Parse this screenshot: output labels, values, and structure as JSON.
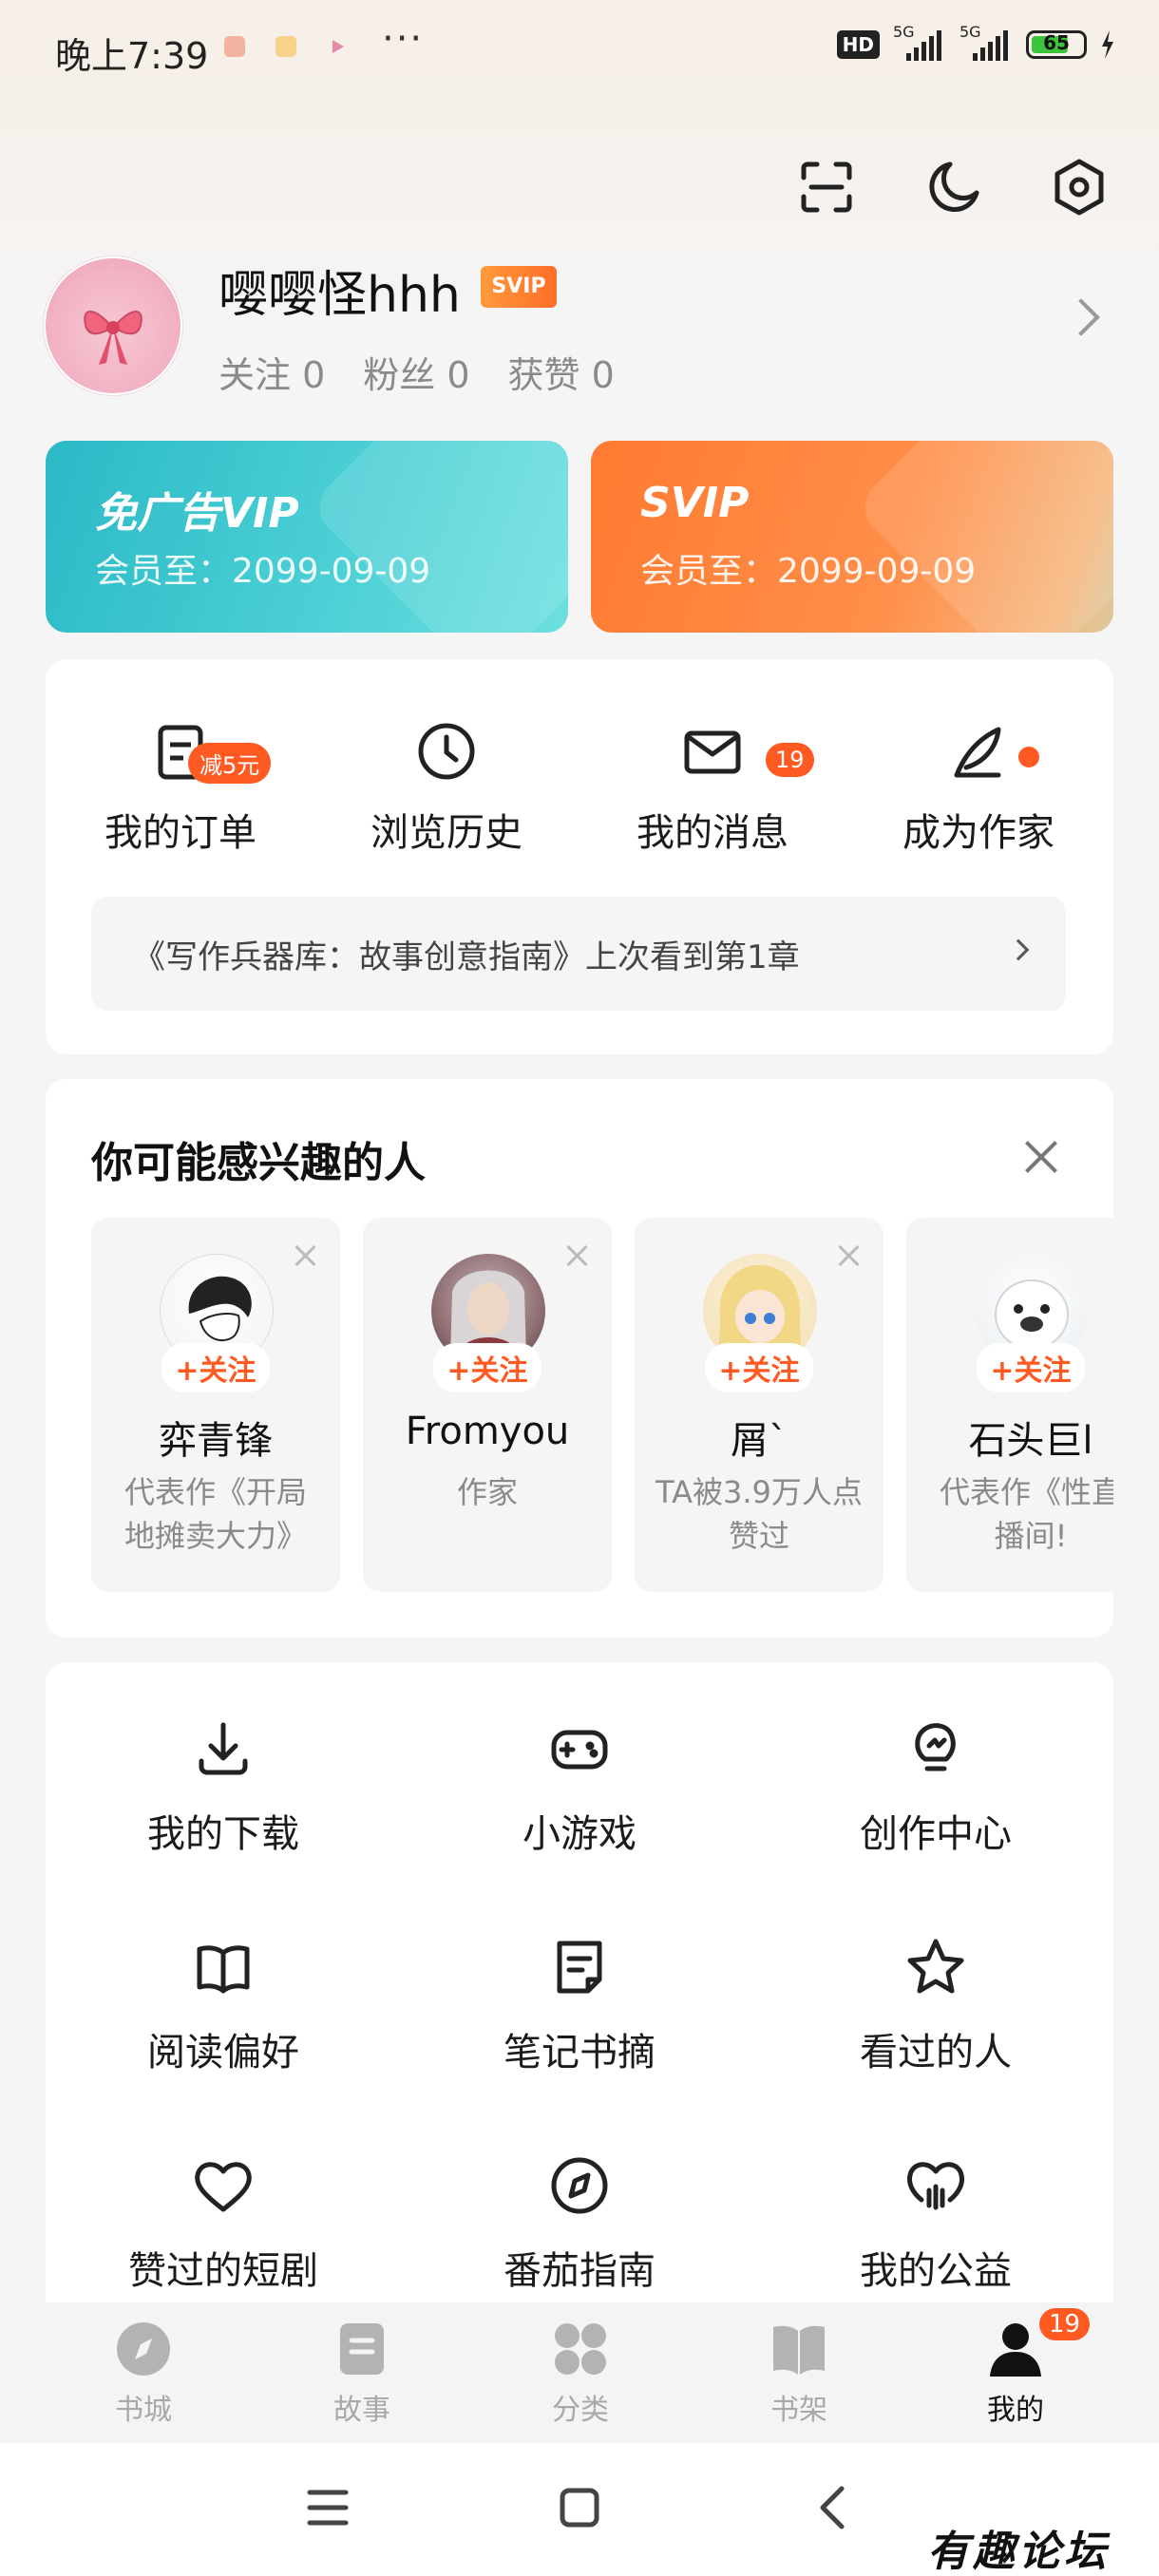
{
  "status_bar": {
    "time": "晚上7:39",
    "dots": "···",
    "hd": "HD",
    "net1": "5G",
    "net2": "5G",
    "battery": "65"
  },
  "profile": {
    "username": "嘤嘤怪hhh",
    "badge": "SVIP",
    "stats": [
      "关注 0",
      "粉丝 0",
      "获赞 0"
    ]
  },
  "vip_cards": [
    {
      "title": "免广告VIP",
      "sub": "会员至：2099-09-09",
      "color": "#2bb9c6"
    },
    {
      "title": "SVIP",
      "sub": "会员至：2099-09-09",
      "color": "#ff7a31"
    }
  ],
  "quick_actions": [
    {
      "label": "我的订单",
      "icon": "order-icon",
      "badge": "减5元"
    },
    {
      "label": "浏览历史",
      "icon": "clock-icon",
      "badge": ""
    },
    {
      "label": "我的消息",
      "icon": "mail-icon",
      "badge": "19"
    },
    {
      "label": "成为作家",
      "icon": "quill-icon",
      "badge": ""
    }
  ],
  "history": {
    "text": "《写作兵器库：故事创意指南》上次看到第1章"
  },
  "recommend": {
    "title": "你可能感兴趣的人",
    "follow_label": "+关注",
    "people": [
      {
        "name": "弈青锋",
        "desc": "代表作《开局地摊卖大力》"
      },
      {
        "name": "Fromyou",
        "desc": "作家"
      },
      {
        "name": "屑`",
        "desc": "TA被3.9万人点赞过"
      },
      {
        "name": "石头巨l",
        "desc": "代表作《性直播间!"
      }
    ]
  },
  "grid": [
    {
      "label": "我的下载",
      "icon": "download-icon"
    },
    {
      "label": "小游戏",
      "icon": "gamepad-icon"
    },
    {
      "label": "创作中心",
      "icon": "bulb-icon"
    },
    {
      "label": "阅读偏好",
      "icon": "book-icon"
    },
    {
      "label": "笔记书摘",
      "icon": "note-icon"
    },
    {
      "label": "看过的人",
      "icon": "star-icon"
    },
    {
      "label": "赞过的短剧",
      "icon": "heart-icon"
    },
    {
      "label": "番茄指南",
      "icon": "compass-icon"
    },
    {
      "label": "我的公益",
      "icon": "charity-icon"
    }
  ],
  "tabs": [
    {
      "label": "书城",
      "icon": "compass-tab-icon"
    },
    {
      "label": "故事",
      "icon": "story-tab-icon"
    },
    {
      "label": "分类",
      "icon": "category-tab-icon"
    },
    {
      "label": "书架",
      "icon": "bookshelf-tab-icon"
    },
    {
      "label": "我的",
      "icon": "me-tab-icon",
      "badge": "19"
    }
  ],
  "watermark": "有趣论坛",
  "colors": {
    "accent": "#ff5a22",
    "text": "#1b1b1b",
    "muted": "#8a8a8a"
  }
}
